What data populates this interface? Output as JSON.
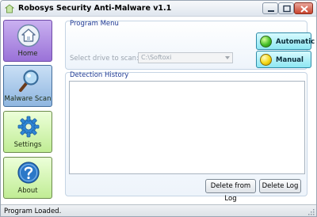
{
  "window": {
    "title": "Robosys Security Anti-Malware v1.1"
  },
  "sidebar": {
    "items": [
      {
        "label": "Home",
        "icon": "house-icon",
        "state": "active"
      },
      {
        "label": "Malware Scan",
        "icon": "magnifier-icon",
        "state": "selected"
      },
      {
        "label": "Settings",
        "icon": "gear-icon",
        "state": "inactive"
      },
      {
        "label": "About",
        "icon": "question-icon",
        "state": "inactive"
      }
    ]
  },
  "program_menu": {
    "title": "Program Menu",
    "drive_label": "Select drive to scan:",
    "drive_value": "C:\\Softoxi",
    "buttons": [
      {
        "label": "Automatic",
        "color": "#47c12a"
      },
      {
        "label": "Manual",
        "color": "#f5d916"
      }
    ]
  },
  "detection_history": {
    "title": "Detection History",
    "delete_from_log": "Delete from Log",
    "delete_log": "Delete Log"
  },
  "status": {
    "text": "Program Loaded."
  },
  "colors": {
    "accent_purple": "#9a72d8",
    "accent_green": "#c0ec94",
    "accent_blue": "#8fb6e0",
    "group_title": "#1f3a94"
  }
}
